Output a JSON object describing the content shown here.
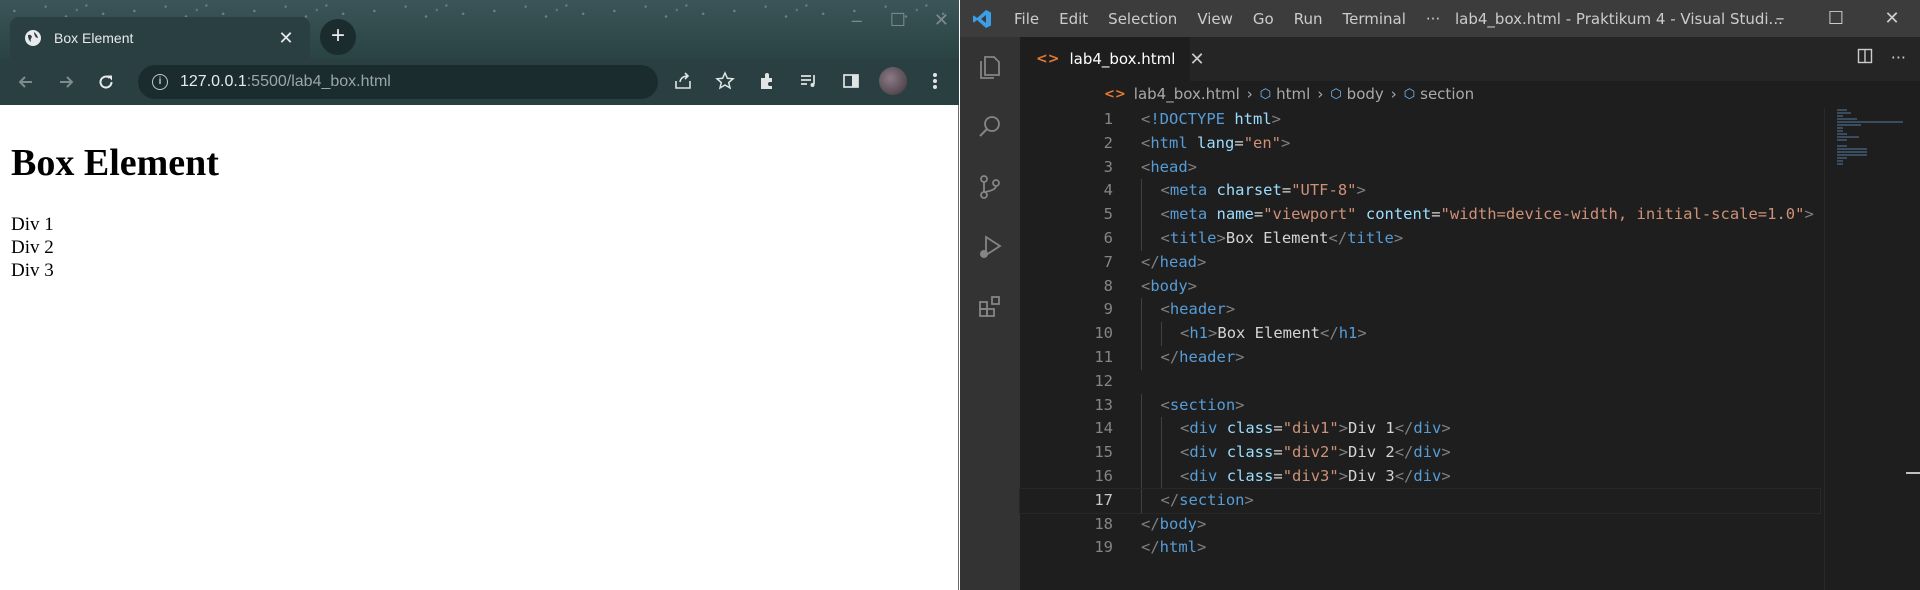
{
  "browser": {
    "tab_title": "Box Element",
    "tab_close": "✕",
    "new_tab": "+",
    "url_host": "127.0.0.1",
    "url_path": ":5500/lab4_box.html",
    "page": {
      "heading": "Box Element",
      "divs": [
        "Div 1",
        "Div 2",
        "Div 3"
      ]
    }
  },
  "vscode": {
    "menu": [
      "File",
      "Edit",
      "Selection",
      "View",
      "Go",
      "Run",
      "Terminal",
      "···"
    ],
    "window_title": "lab4_box.html - Praktikum 4 - Visual Studi...",
    "tab": {
      "icon": "<>",
      "label": "lab4_box.html",
      "close": "✕"
    },
    "breadcrumb": {
      "file": "lab4_box.html",
      "items": [
        "html",
        "body",
        "section"
      ]
    },
    "current_line": 17,
    "lines": [
      {
        "n": "1",
        "indent": 0,
        "tokens": [
          {
            "c": "t",
            "v": "<"
          },
          {
            "c": "tg",
            "v": "!DOCTYPE"
          },
          {
            "c": "tx",
            "v": " "
          },
          {
            "c": "at",
            "v": "html"
          },
          {
            "c": "t",
            "v": ">"
          }
        ]
      },
      {
        "n": "2",
        "indent": 0,
        "tokens": [
          {
            "c": "t",
            "v": "<"
          },
          {
            "c": "tg",
            "v": "html"
          },
          {
            "c": "tx",
            "v": " "
          },
          {
            "c": "at",
            "v": "lang"
          },
          {
            "c": "tx",
            "v": "="
          },
          {
            "c": "sv",
            "v": "\"en\""
          },
          {
            "c": "t",
            "v": ">"
          }
        ]
      },
      {
        "n": "3",
        "indent": 0,
        "tokens": [
          {
            "c": "t",
            "v": "<"
          },
          {
            "c": "tg",
            "v": "head"
          },
          {
            "c": "t",
            "v": ">"
          }
        ]
      },
      {
        "n": "4",
        "indent": 1,
        "tokens": [
          {
            "c": "t",
            "v": "<"
          },
          {
            "c": "tg",
            "v": "meta"
          },
          {
            "c": "tx",
            "v": " "
          },
          {
            "c": "at",
            "v": "charset"
          },
          {
            "c": "tx",
            "v": "="
          },
          {
            "c": "sv",
            "v": "\"UTF-8\""
          },
          {
            "c": "t",
            "v": ">"
          }
        ]
      },
      {
        "n": "5",
        "indent": 1,
        "tokens": [
          {
            "c": "t",
            "v": "<"
          },
          {
            "c": "tg",
            "v": "meta"
          },
          {
            "c": "tx",
            "v": " "
          },
          {
            "c": "at",
            "v": "name"
          },
          {
            "c": "tx",
            "v": "="
          },
          {
            "c": "sv",
            "v": "\"viewport\""
          },
          {
            "c": "tx",
            "v": " "
          },
          {
            "c": "at",
            "v": "content"
          },
          {
            "c": "tx",
            "v": "="
          },
          {
            "c": "sv",
            "v": "\"width=device-width, initial-scale=1.0\""
          },
          {
            "c": "t",
            "v": ">"
          }
        ]
      },
      {
        "n": "6",
        "indent": 1,
        "tokens": [
          {
            "c": "t",
            "v": "<"
          },
          {
            "c": "tg",
            "v": "title"
          },
          {
            "c": "t",
            "v": ">"
          },
          {
            "c": "tx",
            "v": "Box Element"
          },
          {
            "c": "t",
            "v": "</"
          },
          {
            "c": "tg",
            "v": "title"
          },
          {
            "c": "t",
            "v": ">"
          }
        ]
      },
      {
        "n": "7",
        "indent": 0,
        "tokens": [
          {
            "c": "t",
            "v": "</"
          },
          {
            "c": "tg",
            "v": "head"
          },
          {
            "c": "t",
            "v": ">"
          }
        ]
      },
      {
        "n": "8",
        "indent": 0,
        "tokens": [
          {
            "c": "t",
            "v": "<"
          },
          {
            "c": "tg",
            "v": "body"
          },
          {
            "c": "t",
            "v": ">"
          }
        ]
      },
      {
        "n": "9",
        "indent": 1,
        "tokens": [
          {
            "c": "t",
            "v": "<"
          },
          {
            "c": "tg",
            "v": "header"
          },
          {
            "c": "t",
            "v": ">"
          }
        ]
      },
      {
        "n": "10",
        "indent": 2,
        "tokens": [
          {
            "c": "t",
            "v": "<"
          },
          {
            "c": "tg",
            "v": "h1"
          },
          {
            "c": "t",
            "v": ">"
          },
          {
            "c": "tx",
            "v": "Box Element"
          },
          {
            "c": "t",
            "v": "</"
          },
          {
            "c": "tg",
            "v": "h1"
          },
          {
            "c": "t",
            "v": ">"
          }
        ]
      },
      {
        "n": "11",
        "indent": 1,
        "tokens": [
          {
            "c": "t",
            "v": "</"
          },
          {
            "c": "tg",
            "v": "header"
          },
          {
            "c": "t",
            "v": ">"
          }
        ]
      },
      {
        "n": "12",
        "indent": 0,
        "tokens": []
      },
      {
        "n": "13",
        "indent": 1,
        "tokens": [
          {
            "c": "t",
            "v": "<"
          },
          {
            "c": "tg",
            "v": "section"
          },
          {
            "c": "t",
            "v": ">"
          }
        ]
      },
      {
        "n": "14",
        "indent": 2,
        "tokens": [
          {
            "c": "t",
            "v": "<"
          },
          {
            "c": "tg",
            "v": "div"
          },
          {
            "c": "tx",
            "v": " "
          },
          {
            "c": "at",
            "v": "class"
          },
          {
            "c": "tx",
            "v": "="
          },
          {
            "c": "sv",
            "v": "\"div1\""
          },
          {
            "c": "t",
            "v": ">"
          },
          {
            "c": "tx",
            "v": "Div 1"
          },
          {
            "c": "t",
            "v": "</"
          },
          {
            "c": "tg",
            "v": "div"
          },
          {
            "c": "t",
            "v": ">"
          }
        ]
      },
      {
        "n": "15",
        "indent": 2,
        "tokens": [
          {
            "c": "t",
            "v": "<"
          },
          {
            "c": "tg",
            "v": "div"
          },
          {
            "c": "tx",
            "v": " "
          },
          {
            "c": "at",
            "v": "class"
          },
          {
            "c": "tx",
            "v": "="
          },
          {
            "c": "sv",
            "v": "\"div2\""
          },
          {
            "c": "t",
            "v": ">"
          },
          {
            "c": "tx",
            "v": "Div 2"
          },
          {
            "c": "t",
            "v": "</"
          },
          {
            "c": "tg",
            "v": "div"
          },
          {
            "c": "t",
            "v": ">"
          }
        ]
      },
      {
        "n": "16",
        "indent": 2,
        "tokens": [
          {
            "c": "t",
            "v": "<"
          },
          {
            "c": "tg",
            "v": "div"
          },
          {
            "c": "tx",
            "v": " "
          },
          {
            "c": "at",
            "v": "class"
          },
          {
            "c": "tx",
            "v": "="
          },
          {
            "c": "sv",
            "v": "\"div3\""
          },
          {
            "c": "t",
            "v": ">"
          },
          {
            "c": "tx",
            "v": "Div 3"
          },
          {
            "c": "t",
            "v": "</"
          },
          {
            "c": "tg",
            "v": "div"
          },
          {
            "c": "t",
            "v": ">"
          }
        ]
      },
      {
        "n": "17",
        "indent": 1,
        "tokens": [
          {
            "c": "t",
            "v": "</"
          },
          {
            "c": "tg",
            "v": "section"
          },
          {
            "c": "t",
            "v": ">"
          }
        ]
      },
      {
        "n": "18",
        "indent": 0,
        "tokens": [
          {
            "c": "t",
            "v": "</"
          },
          {
            "c": "tg",
            "v": "body"
          },
          {
            "c": "t",
            "v": ">"
          }
        ]
      },
      {
        "n": "19",
        "indent": 0,
        "tokens": [
          {
            "c": "t",
            "v": "</"
          },
          {
            "c": "tg",
            "v": "html"
          },
          {
            "c": "t",
            "v": ">"
          }
        ]
      }
    ]
  }
}
